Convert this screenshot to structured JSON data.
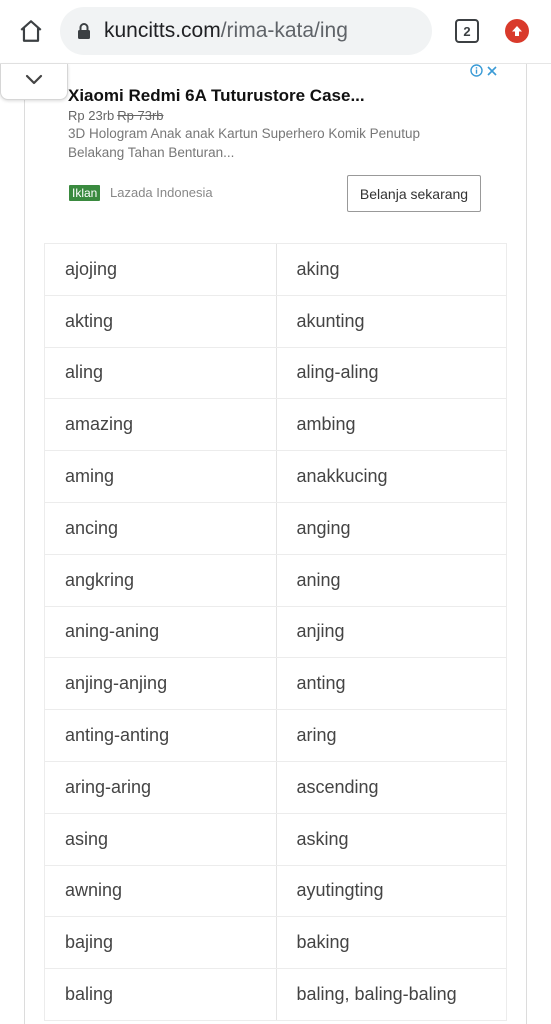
{
  "browser": {
    "url_domain": "kuncitts.com",
    "url_path": "/rima-kata/ing",
    "tab_count": "2"
  },
  "ad": {
    "title": "Xiaomi Redmi 6A Tuturustore Case...",
    "price": "Rp 23rb",
    "old_price": "Rp 73rb",
    "description": "3D Hologram Anak anak Kartun Superhero Komik Penutup Belakang Tahan Benturan...",
    "badge": "Iklan",
    "source": "Lazada Indonesia",
    "cta": "Belanja sekarang"
  },
  "words": [
    [
      "ajojing",
      "aking"
    ],
    [
      "akting",
      "akunting"
    ],
    [
      "aling",
      "aling-aling"
    ],
    [
      "amazing",
      "ambing"
    ],
    [
      "aming",
      "anakkucing"
    ],
    [
      "ancing",
      "anging"
    ],
    [
      "angkring",
      "aning"
    ],
    [
      "aning-aning",
      "anjing"
    ],
    [
      "anjing-anjing",
      "anting"
    ],
    [
      "anting-anting",
      "aring"
    ],
    [
      "aring-aring",
      "ascending"
    ],
    [
      "asing",
      "asking"
    ],
    [
      "awning",
      "ayutingting"
    ],
    [
      "bajing",
      "baking"
    ],
    [
      "baling",
      "baling, baling-baling"
    ]
  ]
}
